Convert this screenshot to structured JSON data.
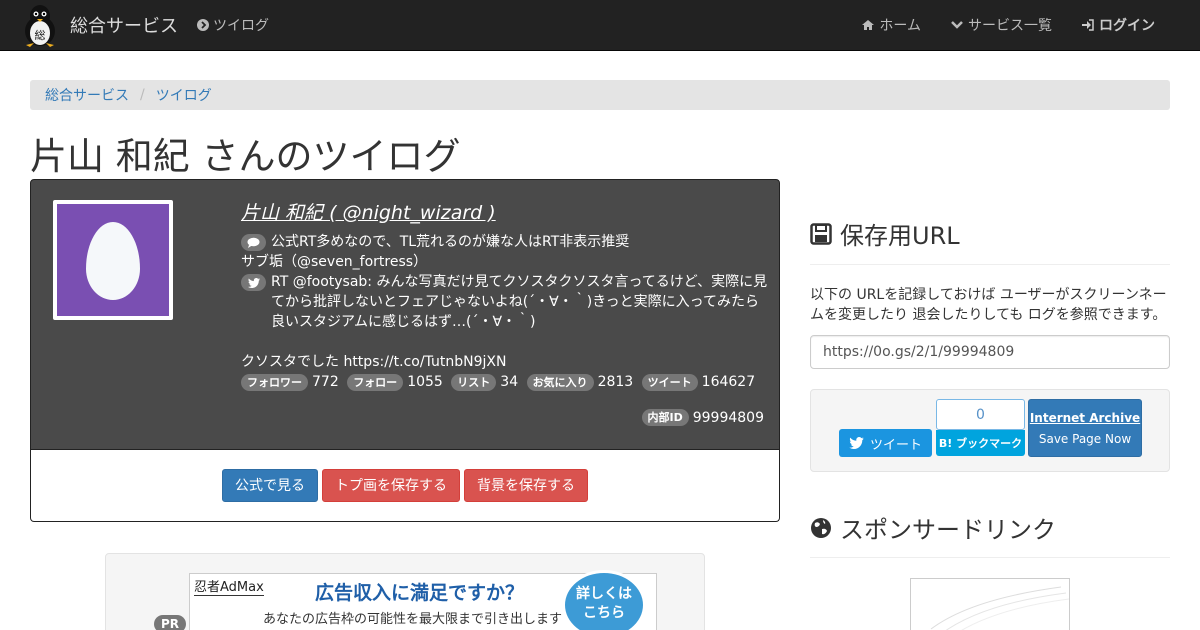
{
  "navbar": {
    "brand": "総合サービス",
    "logo_char": "総",
    "section": "ツイログ",
    "links": [
      {
        "label": "ホーム",
        "icon": "home-icon"
      },
      {
        "label": "サービス一覧",
        "icon": "chevron-down-icon"
      },
      {
        "label": "ログイン",
        "icon": "sign-in-icon"
      }
    ]
  },
  "breadcrumb": {
    "items": [
      "総合サービス",
      "ツイログ"
    ],
    "separator": "/"
  },
  "page": {
    "title": "片山 和紀 さんのツイログ"
  },
  "profile": {
    "name": "片山 和紀 ( @night_wizard )",
    "bio_line1": "公式RT多めなので、TL荒れるのが嫌な人はRT非表示推奨",
    "bio_line2": "サブ垢（@seven_fortress）",
    "tweet": "RT @footysab: みんな写真だけ見てクソスタクソスタ言ってるけど、実際に見てから批評しないとフェアじゃないよね(´・∀・｀)きっと実際に入ってみたら良いスタジアムに感じるはず…(´・∀・｀)",
    "tweet_tail": "クソスタでした https://t.co/TutnbN9jXN",
    "stats": [
      {
        "label": "フォロワー",
        "value": "772"
      },
      {
        "label": "フォロー",
        "value": "1055"
      },
      {
        "label": "リスト",
        "value": "34"
      },
      {
        "label": "お気に入り",
        "value": "2813"
      },
      {
        "label": "ツイート",
        "value": "164627"
      }
    ],
    "internal_label": "内部ID",
    "internal_id": "99994809",
    "avatar_color": "#7a4fb2"
  },
  "actions": {
    "official": "公式で見る",
    "save_icon": "トプ画を保存する",
    "save_bg": "背景を保存する"
  },
  "ad": {
    "pr": "PR",
    "brand": "忍者AdMax",
    "headline": "広告収入に満足ですか？",
    "sub": "あなたの広告枠の可能性を最大限まで引き出します",
    "circle_line1": "詳しくは",
    "circle_line2": "こちら"
  },
  "sidebar": {
    "save_heading": "保存用URL",
    "save_text": "以下の URLを記録しておけば ユーザーがスクリーンネームを変更したり 退会したりしても ログを参照できます。",
    "url": "https://0o.gs/2/1/99994809",
    "tweet_label": "ツイート",
    "hatena_count": "0",
    "hatena_label": "B! ブックマーク",
    "ia_title": "Internet Archive",
    "ia_sub": "Save Page Now",
    "sponsor_heading": "スポンサードリンク"
  }
}
